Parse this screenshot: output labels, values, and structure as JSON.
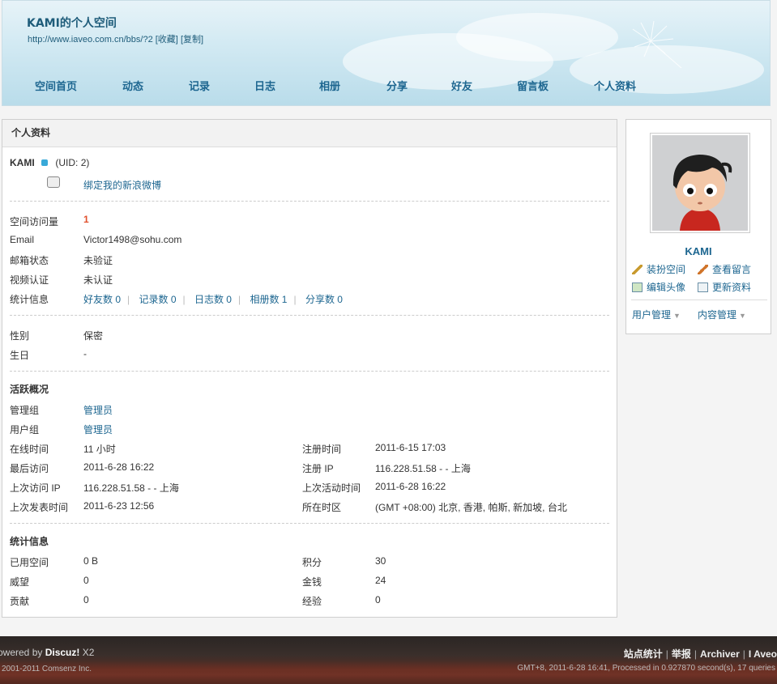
{
  "header": {
    "title": "KAMI的个人空间",
    "url": "http://www.iaveo.com.cn/bbs/?2",
    "bookmark": "[收藏]",
    "copy": "[复制]",
    "nav": [
      "空间首页",
      "动态",
      "记录",
      "日志",
      "相册",
      "分享",
      "好友",
      "留言板",
      "个人资料"
    ]
  },
  "main": {
    "heading": "个人资料",
    "username": "KAMI",
    "uid": "(UID: 2)",
    "weibo_link": "绑定我的新浪微博",
    "basic": [
      {
        "label": "空间访问量",
        "value": "1"
      },
      {
        "label": "Email",
        "value": "Victor1498@sohu.com"
      },
      {
        "label": "邮箱状态",
        "value": "未验证"
      },
      {
        "label": "视频认证",
        "value": "未认证"
      }
    ],
    "stats_label": "统计信息",
    "stats": [
      "好友数 0",
      "记录数 0",
      "日志数 0",
      "相册数 1",
      "分享数 0"
    ],
    "personal": [
      {
        "label": "性别",
        "value": "保密"
      },
      {
        "label": "生日",
        "value": "-"
      }
    ],
    "activity_title": "活跃概况",
    "groups": [
      {
        "label": "管理组",
        "value": "管理员"
      },
      {
        "label": "用户组",
        "value": "管理员"
      }
    ],
    "activity_left": [
      {
        "label": "在线时间",
        "value": "11 小时"
      },
      {
        "label": "最后访问",
        "value": "2011-6-28 16:22"
      },
      {
        "label": "上次访问 IP",
        "value": "116.228.51.58 - - 上海"
      },
      {
        "label": "上次发表时间",
        "value": "2011-6-23 12:56"
      }
    ],
    "activity_right": [
      {
        "label": "注册时间",
        "value": "2011-6-15 17:03"
      },
      {
        "label": "注册 IP",
        "value": "116.228.51.58 - - 上海"
      },
      {
        "label": "上次活动时间",
        "value": "2011-6-28 16:22"
      },
      {
        "label": "所在时区",
        "value": "(GMT +08:00) 北京, 香港, 帕斯, 新加坡, 台北"
      }
    ],
    "statistics_title": "统计信息",
    "statistics_left": [
      {
        "label": "已用空间",
        "value": "0 B"
      },
      {
        "label": "威望",
        "value": "0"
      },
      {
        "label": "贡献",
        "value": "0"
      }
    ],
    "statistics_right": [
      {
        "label": "积分",
        "value": "30"
      },
      {
        "label": "金钱",
        "value": "24"
      },
      {
        "label": "经验",
        "value": "0"
      }
    ]
  },
  "sidebar": {
    "name": "KAMI",
    "links": [
      "装扮空间",
      "查看留言",
      "编辑头像",
      "更新资料"
    ],
    "menus": [
      "用户管理",
      "内容管理"
    ]
  },
  "footer": {
    "powered_prefix": "owered by ",
    "powered_brand": "Discuz!",
    "powered_version": " X2",
    "copyright": "2001-2011 Comsenz Inc.",
    "links": [
      "站点统计",
      "举报",
      "Archiver",
      "I Aveo"
    ],
    "process": "GMT+8, 2011-6-28 16:41, Processed in 0.927870 second(s), 17 queries"
  },
  "colors": {
    "link": "#1d6690",
    "visit_count": "#e1512e"
  }
}
